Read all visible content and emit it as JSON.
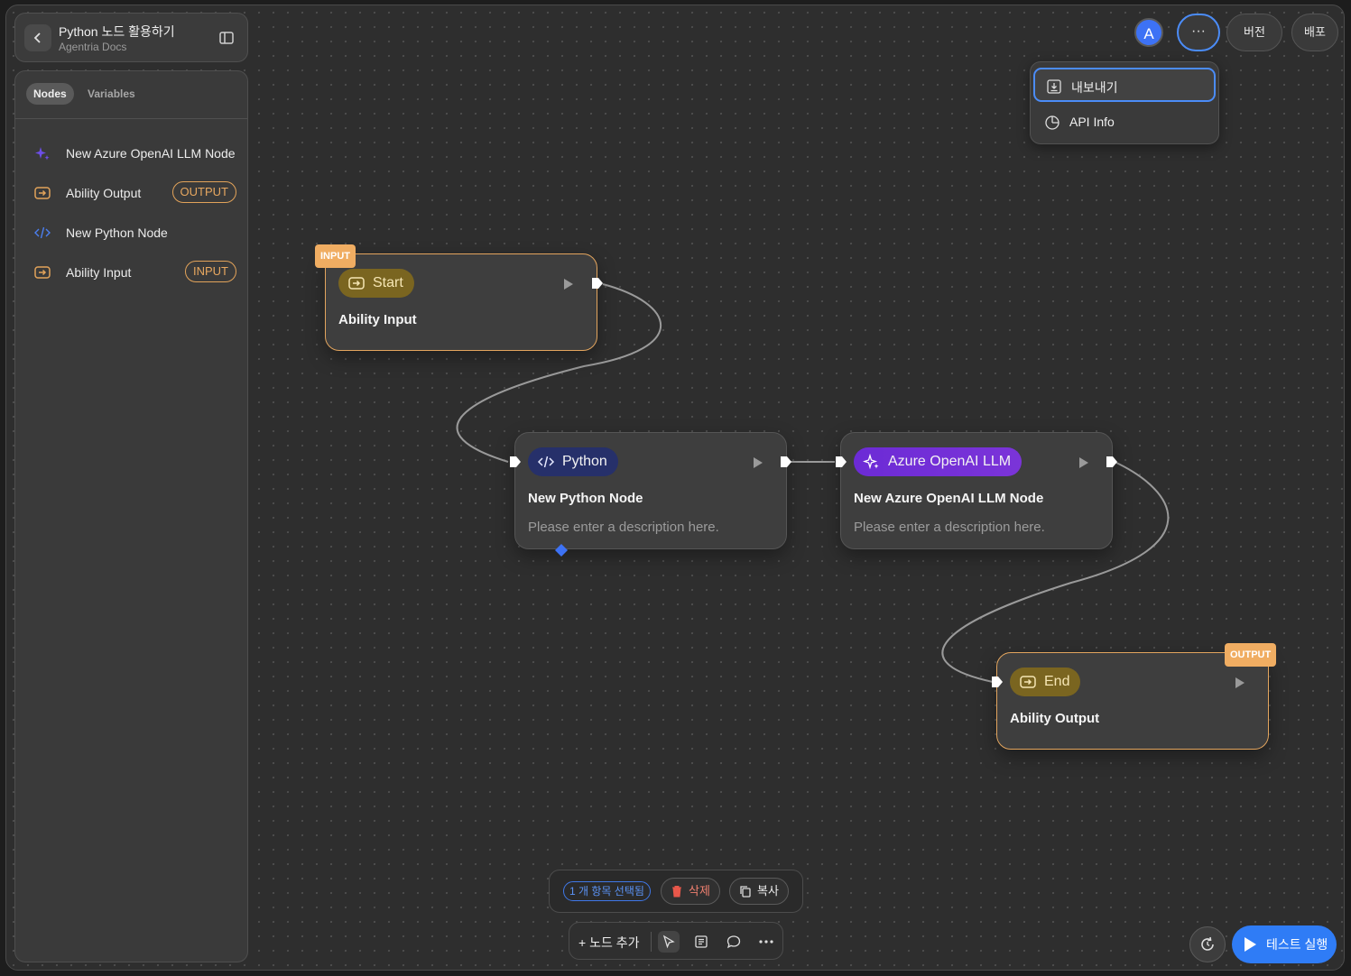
{
  "header": {
    "title": "Python 노드 활용하기",
    "subtitle": "Agentria Docs"
  },
  "sidebar": {
    "tabs": [
      "Nodes",
      "Variables"
    ],
    "items": [
      {
        "label": "New Azure OpenAI LLM Node",
        "icon": "sparkle-icon",
        "badge": ""
      },
      {
        "label": "Ability Output",
        "icon": "io-arrow-icon",
        "badge": "OUTPUT"
      },
      {
        "label": "New Python Node",
        "icon": "code-icon",
        "badge": ""
      },
      {
        "label": "Ability Input",
        "icon": "io-arrow-icon",
        "badge": "INPUT"
      }
    ]
  },
  "topbar": {
    "avatar": "A",
    "more": "···",
    "version": "버전",
    "deploy": "배포"
  },
  "menu": {
    "items": [
      {
        "label": "내보내기",
        "icon": "export-icon"
      },
      {
        "label": "API Info",
        "icon": "api-icon"
      }
    ]
  },
  "nodes": {
    "start": {
      "tag": "INPUT",
      "chip": "Start",
      "title": "Ability Input"
    },
    "python": {
      "chip": "Python",
      "title": "New Python Node",
      "desc": "Please enter a description here."
    },
    "llm": {
      "chip": "Azure OpenAI LLM",
      "title": "New Azure OpenAI LLM Node",
      "desc": "Please enter a description here."
    },
    "end": {
      "tag": "OUTPUT",
      "chip": "End",
      "title": "Ability Output"
    }
  },
  "selection": {
    "count": "1 개 항목 선택됨",
    "delete": "삭제",
    "copy": "복사"
  },
  "toolbar": {
    "add_node": "+ 노드 추가"
  },
  "run": {
    "label": "테스트 실행"
  },
  "colors": {
    "accent": "#2f7cf6",
    "io": "#e3a55e",
    "python_chip": "#26306a",
    "llm_chip": "#6c2bd6"
  }
}
